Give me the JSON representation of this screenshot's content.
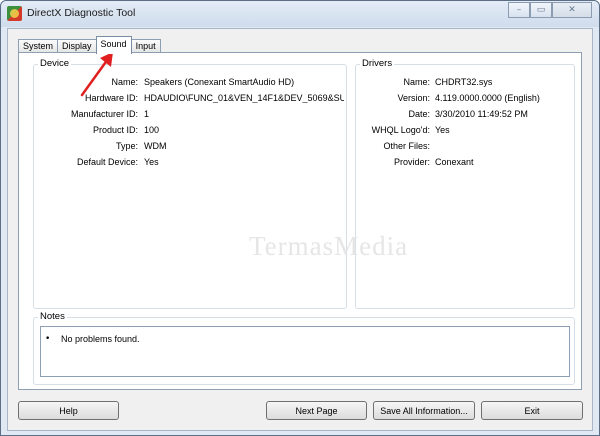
{
  "window": {
    "title": "DirectX Diagnostic Tool",
    "minimize": "–",
    "maximize": "▭",
    "close": "✕"
  },
  "tabs": [
    {
      "label": "System"
    },
    {
      "label": "Display"
    },
    {
      "label": "Sound",
      "selected": true
    },
    {
      "label": "Input"
    }
  ],
  "device": {
    "title": "Device",
    "fields": [
      {
        "label": "Name:",
        "value": "Speakers (Conexant SmartAudio HD)"
      },
      {
        "label": "Hardware ID:",
        "value": "HDAUDIO\\FUNC_01&VEN_14F1&DEV_5069&SUBSY"
      },
      {
        "label": "Manufacturer ID:",
        "value": "1"
      },
      {
        "label": "Product ID:",
        "value": "100"
      },
      {
        "label": "Type:",
        "value": "WDM"
      },
      {
        "label": "Default Device:",
        "value": "Yes"
      }
    ]
  },
  "drivers": {
    "title": "Drivers",
    "fields": [
      {
        "label": "Name:",
        "value": "CHDRT32.sys"
      },
      {
        "label": "Version:",
        "value": "4.119.0000.0000 (English)"
      },
      {
        "label": "Date:",
        "value": "3/30/2010 11:49:52 PM"
      },
      {
        "label": "WHQL Logo'd:",
        "value": "Yes"
      },
      {
        "label": "Other Files:",
        "value": ""
      },
      {
        "label": "Provider:",
        "value": "Conexant"
      }
    ]
  },
  "notes": {
    "title": "Notes",
    "bullet": "•",
    "text": "No problems found."
  },
  "watermark": "TermasMedia",
  "buttons": {
    "help": "Help",
    "next_page": "Next Page",
    "save_all": "Save All Information...",
    "exit": "Exit"
  },
  "colors": {
    "annotation_arrow": "#e02020"
  }
}
